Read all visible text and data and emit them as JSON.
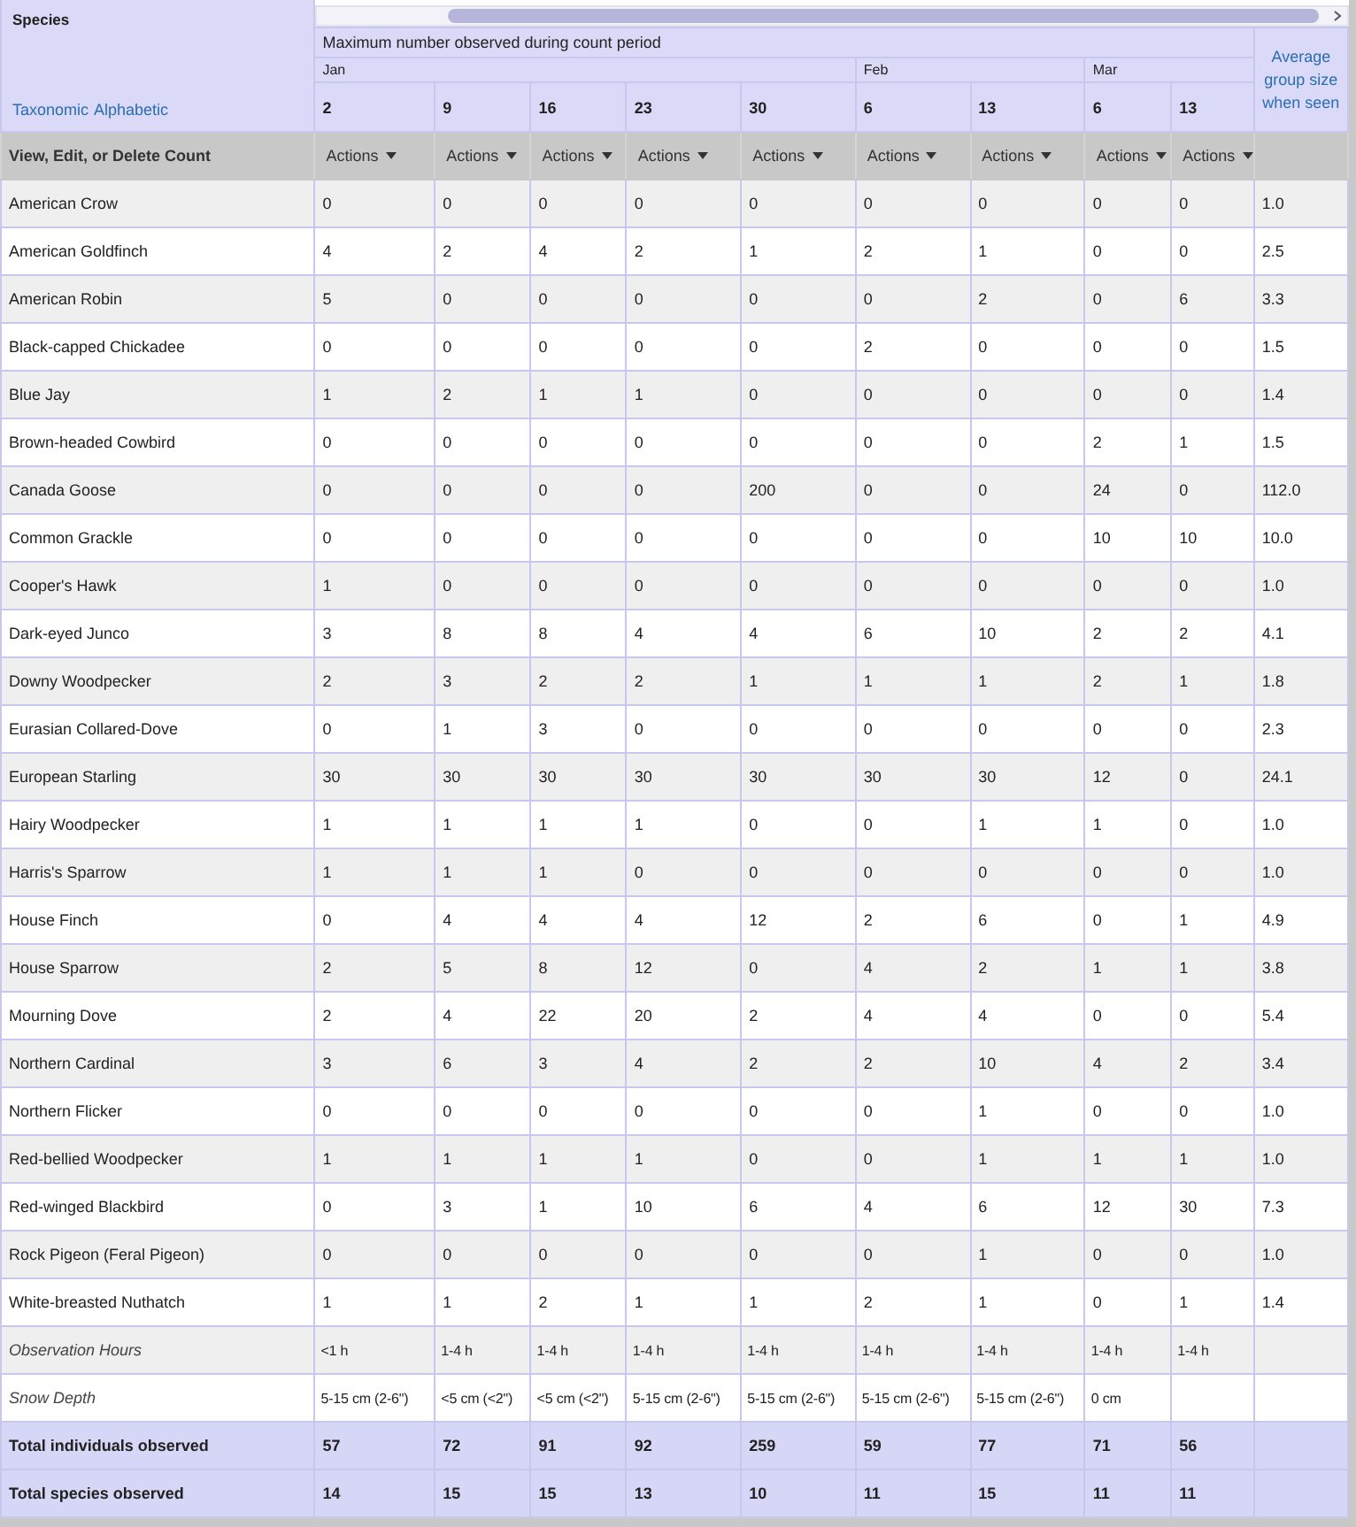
{
  "header": {
    "species_label": "Species",
    "sort_links": [
      "Taxonomic",
      "Alphabetic"
    ],
    "period_title": "Maximum number observed during count period",
    "months": [
      {
        "label": "Jan",
        "days": [
          "2",
          "9",
          "16",
          "23",
          "30"
        ]
      },
      {
        "label": "Feb",
        "days": [
          "6",
          "13"
        ]
      },
      {
        "label": "Mar",
        "days": [
          "6",
          "13"
        ]
      }
    ],
    "average_label": "Average group size when seen"
  },
  "actions_row": {
    "label": "View, Edit, or Delete Count",
    "buttons": [
      "Actions",
      "Actions",
      "Actions",
      "Actions",
      "Actions",
      "Actions",
      "Actions",
      "Actions",
      "Actions"
    ]
  },
  "rows": [
    {
      "kind": "species",
      "name": "American Crow",
      "values": [
        "0",
        "0",
        "0",
        "0",
        "0",
        "0",
        "0",
        "0",
        "0"
      ],
      "average": "1.0"
    },
    {
      "kind": "species",
      "name": "American Goldfinch",
      "values": [
        "4",
        "2",
        "4",
        "2",
        "1",
        "2",
        "1",
        "0",
        "0"
      ],
      "average": "2.5"
    },
    {
      "kind": "species",
      "name": "American Robin",
      "values": [
        "5",
        "0",
        "0",
        "0",
        "0",
        "0",
        "2",
        "0",
        "6"
      ],
      "average": "3.3"
    },
    {
      "kind": "species",
      "name": "Black-capped Chickadee",
      "values": [
        "0",
        "0",
        "0",
        "0",
        "0",
        "2",
        "0",
        "0",
        "0"
      ],
      "average": "1.5"
    },
    {
      "kind": "species",
      "name": "Blue Jay",
      "values": [
        "1",
        "2",
        "1",
        "1",
        "0",
        "0",
        "0",
        "0",
        "0"
      ],
      "average": "1.4"
    },
    {
      "kind": "species",
      "name": "Brown-headed Cowbird",
      "values": [
        "0",
        "0",
        "0",
        "0",
        "0",
        "0",
        "0",
        "2",
        "1"
      ],
      "average": "1.5"
    },
    {
      "kind": "species",
      "name": "Canada Goose",
      "values": [
        "0",
        "0",
        "0",
        "0",
        "200",
        "0",
        "0",
        "24",
        "0"
      ],
      "average": "112.0"
    },
    {
      "kind": "species",
      "name": "Common Grackle",
      "values": [
        "0",
        "0",
        "0",
        "0",
        "0",
        "0",
        "0",
        "10",
        "10"
      ],
      "average": "10.0"
    },
    {
      "kind": "species",
      "name": "Cooper's Hawk",
      "values": [
        "1",
        "0",
        "0",
        "0",
        "0",
        "0",
        "0",
        "0",
        "0"
      ],
      "average": "1.0"
    },
    {
      "kind": "species",
      "name": "Dark-eyed Junco",
      "values": [
        "3",
        "8",
        "8",
        "4",
        "4",
        "6",
        "10",
        "2",
        "2"
      ],
      "average": "4.1"
    },
    {
      "kind": "species",
      "name": "Downy Woodpecker",
      "values": [
        "2",
        "3",
        "2",
        "2",
        "1",
        "1",
        "1",
        "2",
        "1"
      ],
      "average": "1.8"
    },
    {
      "kind": "species",
      "name": "Eurasian Collared-Dove",
      "values": [
        "0",
        "1",
        "3",
        "0",
        "0",
        "0",
        "0",
        "0",
        "0"
      ],
      "average": "2.3"
    },
    {
      "kind": "species",
      "name": "European Starling",
      "values": [
        "30",
        "30",
        "30",
        "30",
        "30",
        "30",
        "30",
        "12",
        "0"
      ],
      "average": "24.1"
    },
    {
      "kind": "species",
      "name": "Hairy Woodpecker",
      "values": [
        "1",
        "1",
        "1",
        "1",
        "0",
        "0",
        "1",
        "1",
        "0"
      ],
      "average": "1.0"
    },
    {
      "kind": "species",
      "name": "Harris's Sparrow",
      "values": [
        "1",
        "1",
        "1",
        "0",
        "0",
        "0",
        "0",
        "0",
        "0"
      ],
      "average": "1.0"
    },
    {
      "kind": "species",
      "name": "House Finch",
      "values": [
        "0",
        "4",
        "4",
        "4",
        "12",
        "2",
        "6",
        "0",
        "1"
      ],
      "average": "4.9"
    },
    {
      "kind": "species",
      "name": "House Sparrow",
      "values": [
        "2",
        "5",
        "8",
        "12",
        "0",
        "4",
        "2",
        "1",
        "1"
      ],
      "average": "3.8"
    },
    {
      "kind": "species",
      "name": "Mourning Dove",
      "values": [
        "2",
        "4",
        "22",
        "20",
        "2",
        "4",
        "4",
        "0",
        "0"
      ],
      "average": "5.4"
    },
    {
      "kind": "species",
      "name": "Northern Cardinal",
      "values": [
        "3",
        "6",
        "3",
        "4",
        "2",
        "2",
        "10",
        "4",
        "2"
      ],
      "average": "3.4"
    },
    {
      "kind": "species",
      "name": "Northern Flicker",
      "values": [
        "0",
        "0",
        "0",
        "0",
        "0",
        "0",
        "1",
        "0",
        "0"
      ],
      "average": "1.0"
    },
    {
      "kind": "species",
      "name": "Red-bellied Woodpecker",
      "values": [
        "1",
        "1",
        "1",
        "1",
        "0",
        "0",
        "1",
        "1",
        "1"
      ],
      "average": "1.0"
    },
    {
      "kind": "species",
      "name": "Red-winged Blackbird",
      "values": [
        "0",
        "3",
        "1",
        "10",
        "6",
        "4",
        "6",
        "12",
        "30"
      ],
      "average": "7.3"
    },
    {
      "kind": "species",
      "name": "Rock Pigeon (Feral Pigeon)",
      "values": [
        "0",
        "0",
        "0",
        "0",
        "0",
        "0",
        "1",
        "0",
        "0"
      ],
      "average": "1.0"
    },
    {
      "kind": "species",
      "name": "White-breasted Nuthatch",
      "values": [
        "1",
        "1",
        "2",
        "1",
        "1",
        "2",
        "1",
        "0",
        "1"
      ],
      "average": "1.4"
    },
    {
      "kind": "effort",
      "name": "Observation Hours",
      "values": [
        "<1 h",
        "1-4 h",
        "1-4 h",
        "1-4 h",
        "1-4 h",
        "1-4 h",
        "1-4 h",
        "1-4 h",
        "1-4 h"
      ]
    },
    {
      "kind": "effort",
      "name": "Snow Depth",
      "values": [
        "5-15 cm (2-6\")",
        "<5 cm (<2\")",
        "<5 cm (<2\")",
        "5-15 cm (2-6\")",
        "5-15 cm (2-6\")",
        "5-15 cm (2-6\")",
        "5-15 cm (2-6\")",
        "0 cm"
      ]
    },
    {
      "kind": "total",
      "name": "Total individuals observed",
      "values": [
        "57",
        "72",
        "91",
        "92",
        "259",
        "59",
        "77",
        "71",
        "56"
      ]
    },
    {
      "kind": "total",
      "name": "Total species observed",
      "values": [
        "14",
        "15",
        "15",
        "13",
        "10",
        "11",
        "15",
        "11",
        "11"
      ]
    }
  ]
}
